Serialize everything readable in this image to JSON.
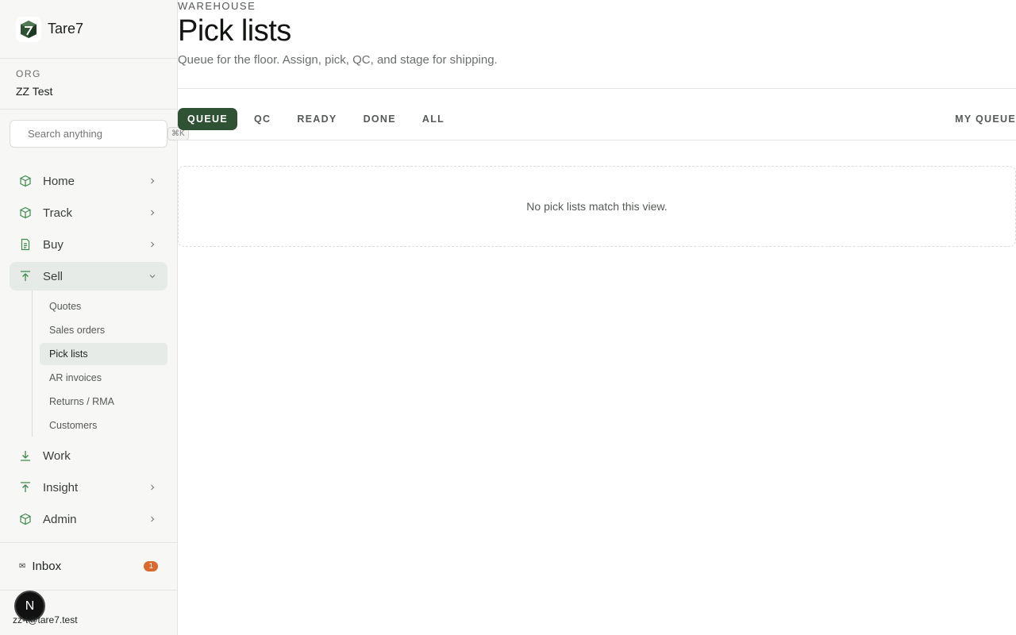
{
  "brand": {
    "name": "Tare7",
    "logo_icon": "cube-logo-icon"
  },
  "org": {
    "label": "ORG",
    "name": "ZZ Test"
  },
  "search": {
    "placeholder": "Search anything",
    "shortcut": "⌘K"
  },
  "nav": {
    "items": [
      {
        "label": "Home",
        "icon": "cube-icon"
      },
      {
        "label": "Track",
        "icon": "cube-icon"
      },
      {
        "label": "Buy",
        "icon": "document-icon"
      },
      {
        "label": "Sell",
        "icon": "arrow-up-icon",
        "expanded": true
      },
      {
        "label": "Work",
        "icon": "arrow-down-icon"
      },
      {
        "label": "Insight",
        "icon": "arrow-up-icon"
      },
      {
        "label": "Admin",
        "icon": "cube-icon"
      }
    ],
    "sell_sub": [
      "Quotes",
      "Sales orders",
      "Pick lists",
      "AR invoices",
      "Returns / RMA",
      "Customers"
    ],
    "active_sub": "Pick lists"
  },
  "inbox": {
    "icon": "✉",
    "label": "Inbox",
    "count": "1"
  },
  "user": {
    "avatar_initial": "N",
    "email": "zz-t@tare7.test"
  },
  "page": {
    "eyebrow": "WAREHOUSE",
    "title": "Pick lists",
    "subtitle": "Queue for the floor. Assign, pick, QC, and stage for shipping."
  },
  "tabs": [
    "QUEUE",
    "QC",
    "READY",
    "DONE",
    "ALL"
  ],
  "active_tab": "QUEUE",
  "my_queue_label": "MY QUEUE",
  "empty_message": "No pick lists match this view.",
  "colors": {
    "accent": "#2f5234",
    "icon_green": "#3c8a4a",
    "badge": "#d9692f"
  }
}
